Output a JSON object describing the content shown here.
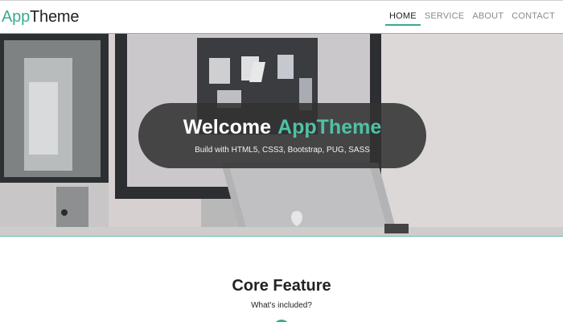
{
  "brand": {
    "part1": "App",
    "part2": "Theme"
  },
  "nav": {
    "items": [
      {
        "label": "HOME",
        "active": true
      },
      {
        "label": "SERVICE",
        "active": false
      },
      {
        "label": "ABOUT",
        "active": false
      },
      {
        "label": "CONTACT",
        "active": false
      }
    ]
  },
  "hero": {
    "title_prefix": "Welcome",
    "title_accent": "AppTheme",
    "subtitle": "Build with HTML5, CSS3, Bootstrap, PUG, SASS"
  },
  "features": {
    "title": "Core Feature",
    "subtitle": "What's included?"
  },
  "colors": {
    "accent": "#3aaa8f",
    "overlay": "#323232",
    "text": "#222222",
    "nav_inactive": "#8a8a8a"
  }
}
